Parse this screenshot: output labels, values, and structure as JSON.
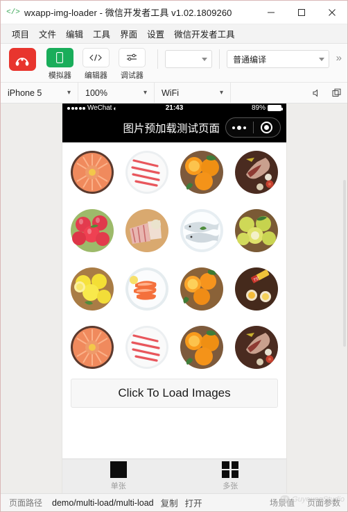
{
  "window": {
    "logo_icon": "code-brackets-icon",
    "title": "wxapp-img-loader - 微信开发者工具 v1.02.1809260",
    "minimize_icon": "minimize-icon",
    "maximize_icon": "maximize-icon",
    "close_icon": "close-icon"
  },
  "menubar": {
    "items": [
      {
        "label": "项目"
      },
      {
        "label": "文件"
      },
      {
        "label": "编辑"
      },
      {
        "label": "工具"
      },
      {
        "label": "界面"
      },
      {
        "label": "设置"
      },
      {
        "label": "微信开发者工具"
      }
    ]
  },
  "toolbar": {
    "account_icon": "wechat-devtools-logo-icon",
    "buttons": [
      {
        "label": "模拟器",
        "icon": "phone-outline-icon"
      },
      {
        "label": "编辑器",
        "icon": "code-brackets-icon"
      },
      {
        "label": "调试器",
        "icon": "sliders-icon"
      }
    ],
    "env_select": {
      "value": "",
      "caret_icon": "chevron-down-icon"
    },
    "compile_select": {
      "value": "普通编译",
      "caret_icon": "chevron-down-icon"
    },
    "overflow_icon": "double-chevron-right-icon"
  },
  "devicebar": {
    "device": "iPhone 5",
    "zoom": "100%",
    "network": "WiFi",
    "mute_icon": "speaker-mute-icon",
    "detach_icon": "detach-window-icon",
    "caret_icon": "chevron-down-icon"
  },
  "simulator": {
    "status_bar": {
      "signal_icon": "signal-dots-icon",
      "carrier": "WeChat",
      "wifi_icon": "wifi-icon",
      "time": "21:43",
      "battery_percent": "89%",
      "battery_icon": "battery-icon"
    },
    "nav_bar": {
      "title": "图片预加载测试页面",
      "menu_icon": "more-dots-icon",
      "target_icon": "target-circle-icon"
    },
    "grid": {
      "rows": [
        [
          {
            "alt": "salmon-platter",
            "kind": "salmon"
          },
          {
            "alt": "sliced-pork-belly",
            "kind": "pork"
          },
          {
            "alt": "oranges-basket",
            "kind": "orange"
          },
          {
            "alt": "lamb-leg-board",
            "kind": "lamb"
          }
        ],
        [
          {
            "alt": "red-apples-bowl",
            "kind": "apples"
          },
          {
            "alt": "raw-pork-ribs-board",
            "kind": "ribs"
          },
          {
            "alt": "fish-plate",
            "kind": "fish"
          },
          {
            "alt": "green-pears-bowl",
            "kind": "pears"
          }
        ],
        [
          {
            "alt": "lemons-bowl",
            "kind": "lemons"
          },
          {
            "alt": "shrimp-plate",
            "kind": "shrimp"
          },
          {
            "alt": "oranges-bowl-leaves",
            "kind": "orange2"
          },
          {
            "alt": "beer-bottle-board",
            "kind": "beer"
          }
        ],
        [
          {
            "alt": "salmon-platter",
            "kind": "salmon"
          },
          {
            "alt": "sliced-pork-belly",
            "kind": "pork"
          },
          {
            "alt": "oranges-basket",
            "kind": "orange"
          },
          {
            "alt": "lamb-leg-board",
            "kind": "lamb"
          }
        ]
      ]
    },
    "load_button": {
      "label": "Click To Load Images"
    },
    "tab_bar": {
      "tabs": [
        {
          "label": "单张",
          "icon": "single-square-icon"
        },
        {
          "label": "多张",
          "icon": "grid-four-squares-icon"
        }
      ]
    }
  },
  "pathbar": {
    "label": "页面路径",
    "path": "demo/multi-load/multi-load",
    "copy": "复制",
    "open": "打开",
    "scene_label": "场景值",
    "params_label": "页面参数",
    "watermark": "GuyoungStudio",
    "watermark_icon": "wechat-logo-icon"
  },
  "colors": {
    "accent_red": "#e8352e",
    "accent_green": "#19ad5a",
    "nav_black": "#000000",
    "chrome_gray": "#fafafa"
  }
}
